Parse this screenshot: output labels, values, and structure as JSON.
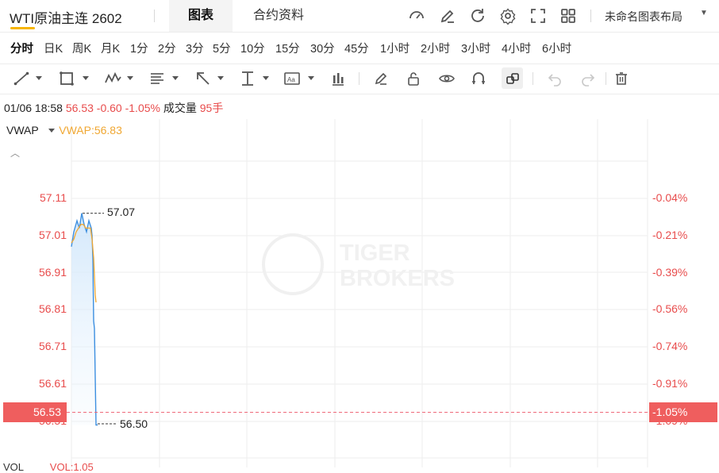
{
  "header": {
    "title": "WTI原油主连 2602",
    "tabs": [
      {
        "label": "图表",
        "active": true
      },
      {
        "label": "合约资料",
        "active": false
      }
    ],
    "icons": [
      "gauge-icon",
      "pencil-icon",
      "refresh-icon",
      "gear-icon",
      "fullscreen-icon",
      "grid-icon"
    ],
    "layout_label": "未命名图表布局"
  },
  "periods": [
    "分时",
    "日K",
    "周K",
    "月K",
    "1分",
    "2分",
    "3分",
    "5分",
    "10分",
    "15分",
    "30分",
    "45分",
    "1小时",
    "2小时",
    "3小时",
    "4小时",
    "6小时"
  ],
  "active_period": "分时",
  "drawing_tools": [
    "line-tool-icon",
    "rectangle-tool-icon",
    "pattern-tool-icon",
    "fibonacci-tool-icon",
    "arrow-tool-icon",
    "measure-tool-icon",
    "text-tool-icon",
    "bar-tool-icon",
    "brush-icon",
    "lock-icon",
    "eye-icon",
    "magnet-icon",
    "link-icon",
    "undo-icon",
    "redo-icon",
    "trash-icon"
  ],
  "quote": {
    "time": "01/06 18:58",
    "price": "56.53",
    "change": "-0.60",
    "change_pct": "-1.05%",
    "volume_label": "成交量",
    "volume": "95手"
  },
  "indicator": {
    "name": "VWAP",
    "value_label": "VWAP:56.83"
  },
  "watermark": {
    "line1": "TIGER",
    "line2": "BROKERS"
  },
  "chart_data": {
    "type": "line",
    "y_ticks": [
      "57.11",
      "57.01",
      "56.91",
      "56.81",
      "56.71",
      "56.61",
      "56.51"
    ],
    "pct_ticks": [
      "-0.04%",
      "-0.21%",
      "-0.39%",
      "-0.56%",
      "-0.74%",
      "-0.91%",
      "-1.09%"
    ],
    "ylim": [
      56.49,
      57.13
    ],
    "high_marker": "57.07",
    "low_marker": "56.50",
    "last_price_tag": "56.53",
    "last_pct_tag": "-1.05%",
    "series": [
      {
        "values": [
          56.98,
          57.02,
          57.05,
          57.03,
          57.07,
          57.04,
          57.02,
          57.05,
          57.03,
          57.01,
          56.95,
          56.78,
          56.76,
          56.5,
          56.5
        ]
      },
      {
        "values": [
          56.99,
          57.0,
          57.02,
          57.03,
          57.04,
          57.04,
          57.03,
          57.03,
          57.03,
          57.0,
          56.95,
          56.85,
          56.83
        ]
      }
    ],
    "colors": {
      "price": "#3d8fe0",
      "vwap": "#f0a732",
      "grid": "#eeeeee",
      "up": "#e84c4c"
    }
  },
  "bottom": {
    "vol_label": "VOL",
    "vol_value": "VOL:1.05"
  }
}
